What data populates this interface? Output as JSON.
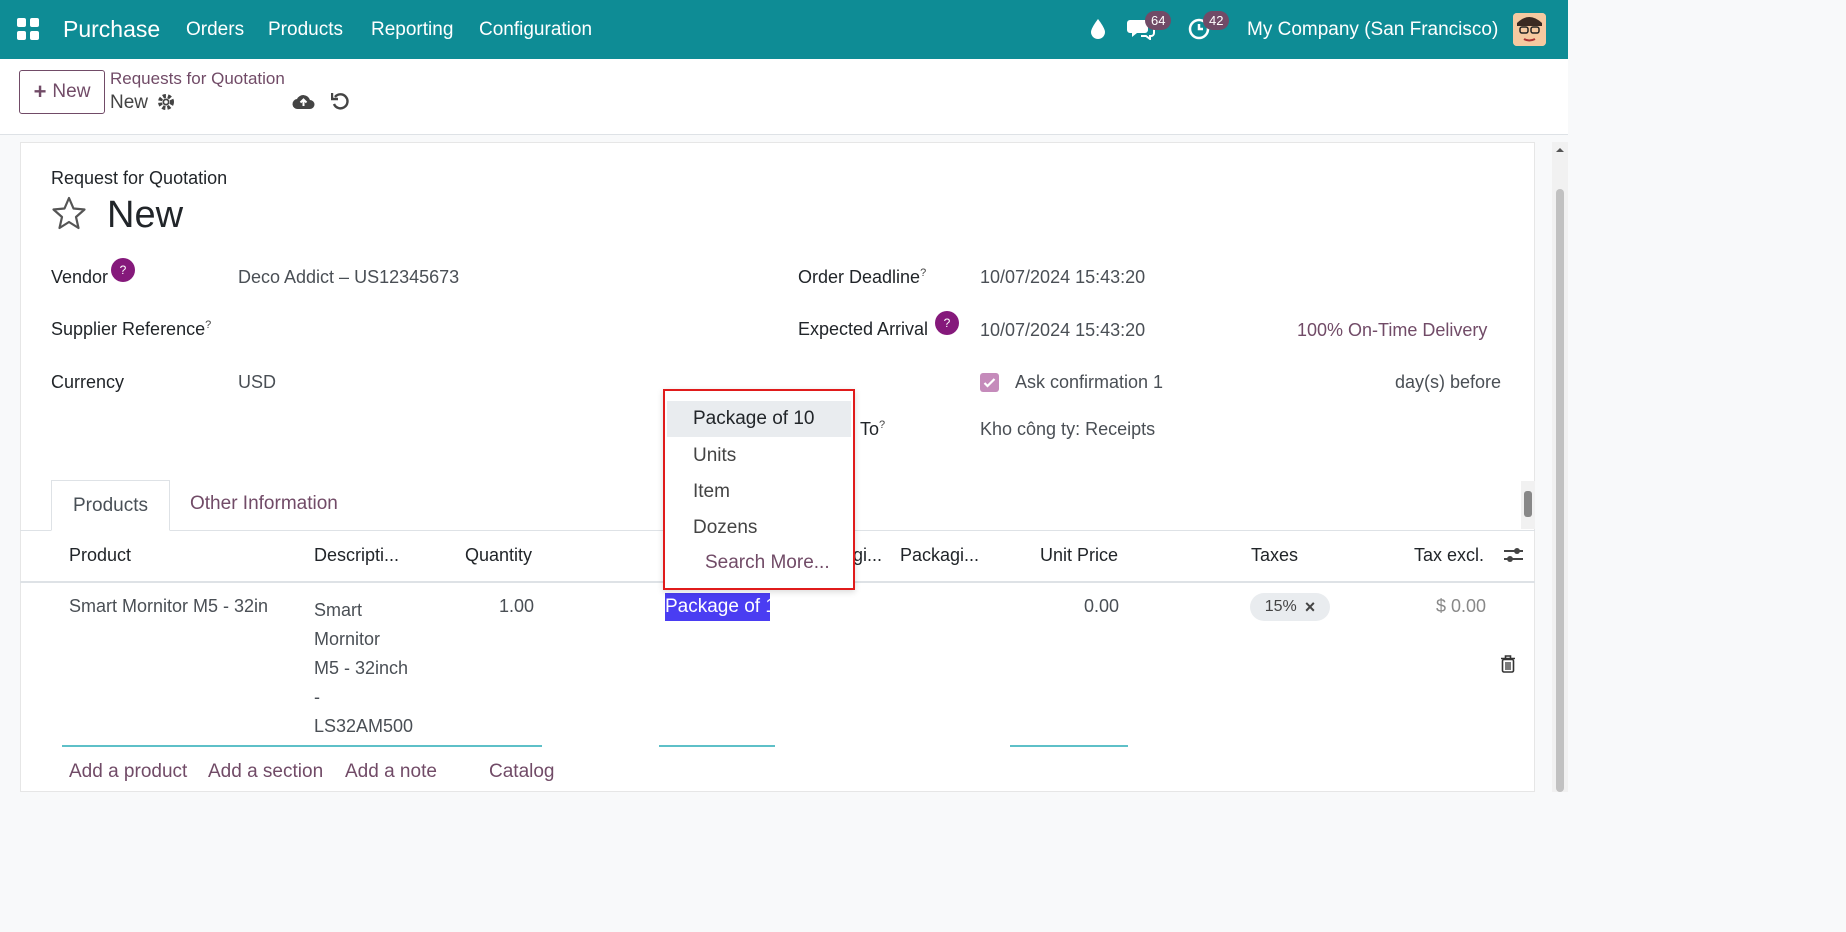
{
  "topnav": {
    "app_name": "Purchase",
    "menu": [
      "Orders",
      "Products",
      "Reporting",
      "Configuration"
    ],
    "messages_count": "64",
    "activities_count": "42",
    "company": "My Company (San Francisco)"
  },
  "control": {
    "new_label": "New",
    "breadcrumb_parent": "Requests for Quotation",
    "breadcrumb_current": "New"
  },
  "form": {
    "doc_type": "Request for Quotation",
    "title": "New",
    "vendor_label": "Vendor",
    "vendor_value": "Deco Addict – US12345673",
    "supplier_ref_label": "Supplier Reference",
    "currency_label": "Currency",
    "currency_value": "USD",
    "order_deadline_label": "Order Deadline",
    "order_deadline_value": "10/07/2024 15:43:20",
    "expected_arrival_label": "Expected Arrival",
    "expected_arrival_value": "10/07/2024 15:43:20",
    "on_time_delivery": "100% On-Time Delivery",
    "ask_confirmation_label": "Ask confirmation 1",
    "ask_confirmation_suffix": "day(s) before",
    "deliver_to_label_visible": "To",
    "deliver_to_value": "Kho công ty: Receipts",
    "help_glyph": "?"
  },
  "tabs": {
    "products": "Products",
    "other": "Other Information"
  },
  "table": {
    "headers": [
      "Product",
      "Descripti...",
      "Quantity",
      "gi...",
      "Packagi...",
      "Unit Price",
      "Taxes",
      "Tax excl."
    ],
    "row": {
      "product": "Smart Mornitor M5 - 32in",
      "description_lines": [
        "Smart",
        "Mornitor",
        "M5 - 32inch",
        "-",
        "LS32AM500"
      ],
      "quantity": "1.00",
      "uom_input": "Package of 1",
      "unit_price": "0.00",
      "tax": "15%",
      "tax_excl": "$ 0.00"
    },
    "add_links": [
      "Add a product",
      "Add a section",
      "Add a note",
      "Catalog"
    ]
  },
  "dropdown": {
    "options": [
      "Package of 10",
      "Units",
      "Item",
      "Dozens"
    ],
    "search_more": "Search More..."
  },
  "colors": {
    "navbar": "#0e8c95",
    "accent": "#714b67",
    "highlight": "#e01b1b",
    "selection": "#4a3df2"
  }
}
